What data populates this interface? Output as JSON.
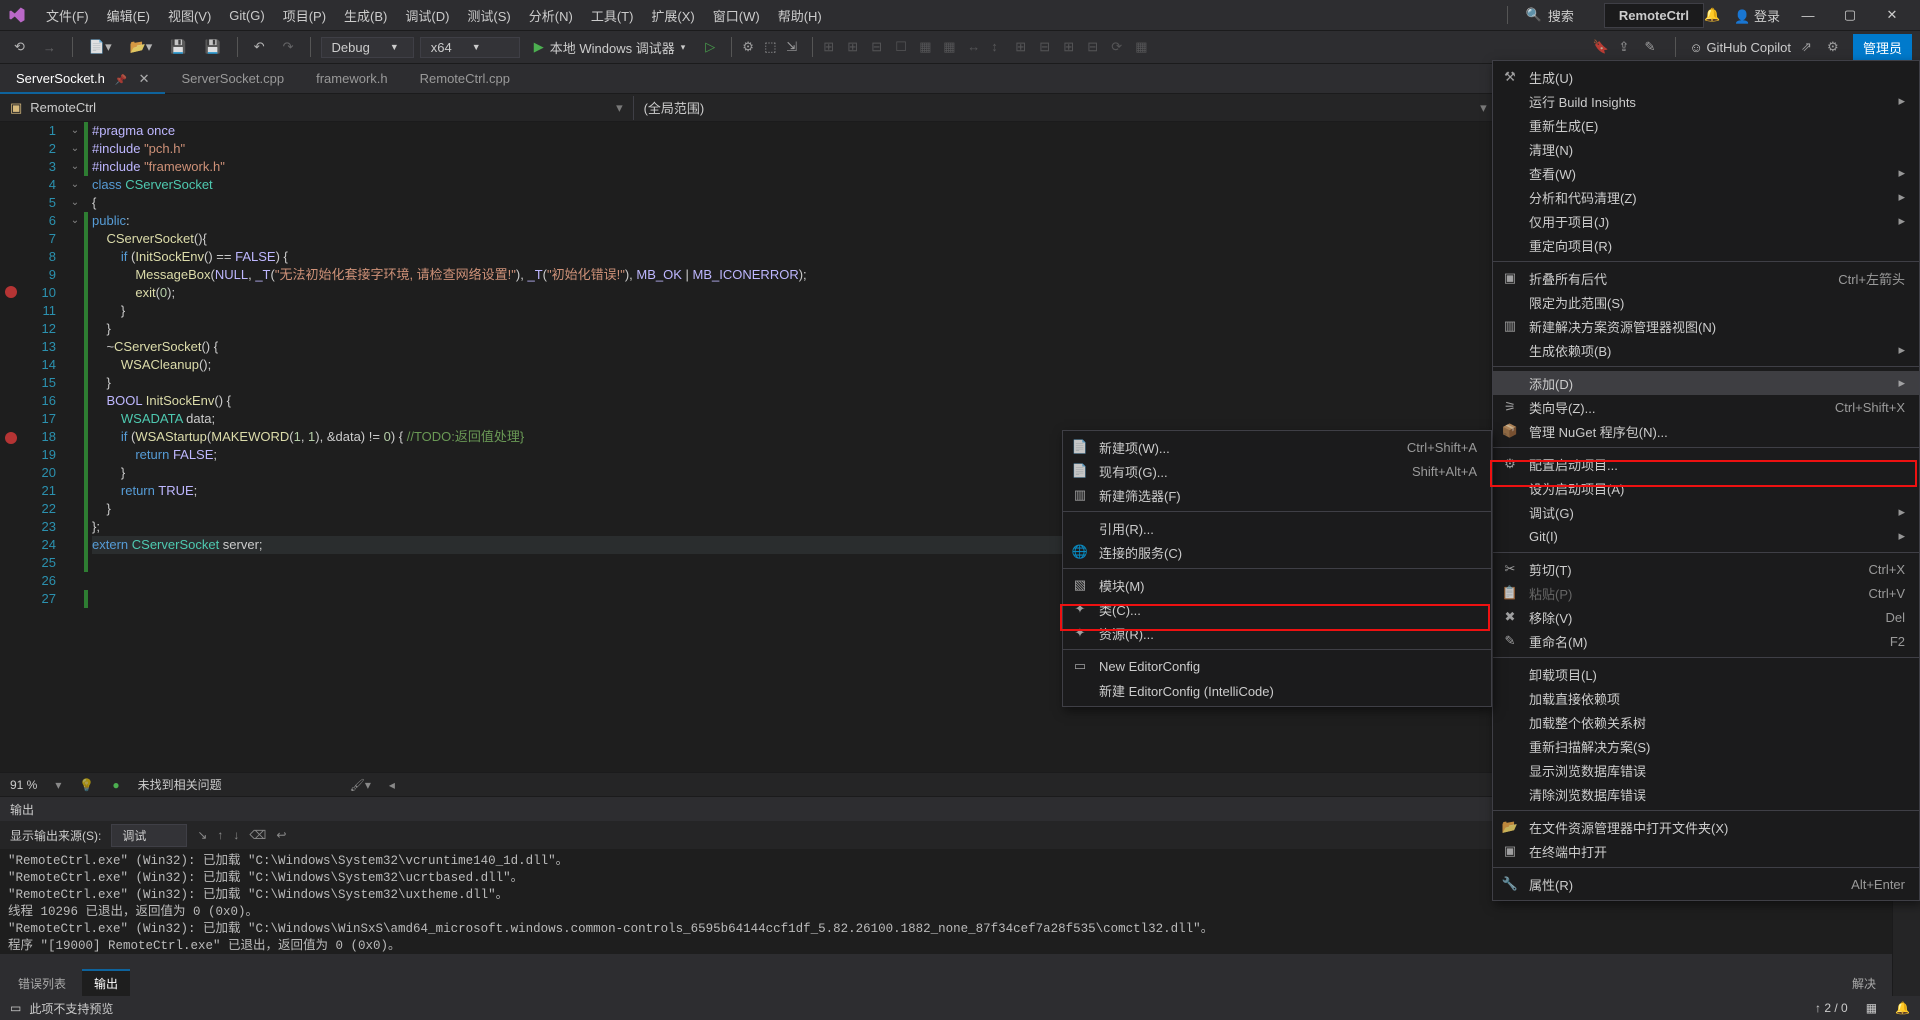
{
  "title": {
    "menus": [
      "文件(F)",
      "编辑(E)",
      "视图(V)",
      "Git(G)",
      "项目(P)",
      "生成(B)",
      "调试(D)",
      "测试(S)",
      "分析(N)",
      "工具(T)",
      "扩展(X)",
      "窗口(W)",
      "帮助(H)"
    ],
    "search_label": "搜索",
    "active_project": "RemoteCtrl",
    "signin": "登录"
  },
  "toolbar": {
    "config": "Debug",
    "platform": "x64",
    "start_label": "本地 Windows 调试器",
    "copilot": "GitHub Copilot",
    "admin": "管理员"
  },
  "tabs": [
    {
      "label": "ServerSocket.h",
      "active": true,
      "pinned": true
    },
    {
      "label": "ServerSocket.cpp"
    },
    {
      "label": "framework.h"
    },
    {
      "label": "RemoteCtrl.cpp"
    }
  ],
  "nav": {
    "class": "RemoteCtrl",
    "scope": "(全局范围)"
  },
  "code": {
    "lines": [
      {
        "n": 1,
        "bp": false,
        "fold": "",
        "g": true,
        "html": "<span class='mac'>#pragma</span> <span class='mac'>once</span>"
      },
      {
        "n": 2,
        "bp": false,
        "fold": "",
        "g": true,
        "html": "<span class='mac'>#include</span> <span class='str'>\"pch.h\"</span>"
      },
      {
        "n": 3,
        "bp": false,
        "fold": "",
        "g": true,
        "html": "<span class='mac'>#include</span> <span class='str'>\"framework.h\"</span>"
      },
      {
        "n": 4,
        "bp": false,
        "fold": "",
        "g": false,
        "html": ""
      },
      {
        "n": 5,
        "bp": false,
        "fold": "",
        "g": false,
        "html": ""
      },
      {
        "n": 6,
        "bp": false,
        "fold": "v",
        "g": true,
        "html": "<span class='kw'>class</span> <span class='cls'>CServerSocket</span>"
      },
      {
        "n": 7,
        "bp": false,
        "fold": "",
        "g": true,
        "html": "{"
      },
      {
        "n": 8,
        "bp": false,
        "fold": "",
        "g": true,
        "html": "<span class='kw'>public</span>:"
      },
      {
        "n": 9,
        "bp": false,
        "fold": "v",
        "g": true,
        "html": "    <span class='fn'>CServerSocket</span>(){"
      },
      {
        "n": 10,
        "bp": true,
        "fold": "v",
        "g": true,
        "html": "        <span class='kw'>if</span> (<span class='fn'>InitSockEnv</span>() == <span class='mac'>FALSE</span>) {"
      },
      {
        "n": 11,
        "bp": false,
        "fold": "",
        "g": true,
        "html": "            <span class='fn'>MessageBox</span>(<span class='mac'>NULL</span>, <span class='mac'>_T</span>(<span class='str'>\"无法初始化套接字环境, 请检查网络设置!\"</span>), <span class='mac'>_T</span>(<span class='str'>\"初始化错误!\"</span>), <span class='mac'>MB_OK</span> | <span class='mac'>MB_ICONERROR</span>);"
      },
      {
        "n": 12,
        "bp": false,
        "fold": "",
        "g": true,
        "html": "            <span class='fn'>exit</span>(<span class='num'>0</span>);"
      },
      {
        "n": 13,
        "bp": false,
        "fold": "",
        "g": true,
        "html": "        }"
      },
      {
        "n": 14,
        "bp": false,
        "fold": "",
        "g": true,
        "html": "    }"
      },
      {
        "n": 15,
        "bp": false,
        "fold": "v",
        "g": true,
        "html": "    ~<span class='fn'>CServerSocket</span>() {"
      },
      {
        "n": 16,
        "bp": false,
        "fold": "",
        "g": true,
        "html": "        <span class='fn'>WSACleanup</span>();"
      },
      {
        "n": 17,
        "bp": false,
        "fold": "",
        "g": true,
        "html": "    }"
      },
      {
        "n": 18,
        "bp": true,
        "fold": "v",
        "g": true,
        "html": "    <span class='mac'>BOOL</span> <span class='fn'>InitSockEnv</span>() {"
      },
      {
        "n": 19,
        "bp": false,
        "fold": "",
        "g": true,
        "html": "        <span class='cls'>WSADATA</span> data;"
      },
      {
        "n": 20,
        "bp": false,
        "fold": "v",
        "g": true,
        "html": "        <span class='kw'>if</span> (<span class='fn'>WSAStartup</span>(<span class='fn'>MAKEWORD</span>(<span class='num'>1</span>, <span class='num'>1</span>), &data) != <span class='num'>0</span>) { <span class='cmt'>//TODO:返回值处理}</span>"
      },
      {
        "n": 21,
        "bp": false,
        "fold": "",
        "g": true,
        "html": "            <span class='kw'>return</span> <span class='mac'>FALSE</span>;"
      },
      {
        "n": 22,
        "bp": false,
        "fold": "",
        "g": true,
        "html": "        }"
      },
      {
        "n": 23,
        "bp": false,
        "fold": "",
        "g": true,
        "html": "        <span class='kw'>return</span> <span class='mac'>TRUE</span>;"
      },
      {
        "n": 24,
        "bp": false,
        "fold": "",
        "g": true,
        "html": "    }"
      },
      {
        "n": 25,
        "bp": false,
        "fold": "",
        "g": true,
        "html": "};"
      },
      {
        "n": 26,
        "bp": false,
        "fold": "",
        "g": false,
        "html": ""
      },
      {
        "n": 27,
        "bp": false,
        "fold": "",
        "g": true,
        "html": "<span class='kw'>extern</span> <span class='cls'>CServerSocket</span> server;",
        "current": true
      }
    ]
  },
  "editor_status": {
    "zoom": "91 %",
    "issues": "未找到相关问题"
  },
  "output": {
    "title": "输出",
    "source_label": "显示输出来源(S):",
    "source_value": "调试",
    "body": "\"RemoteCtrl.exe\" (Win32): 已加载 \"C:\\Windows\\System32\\vcruntime140_1d.dll\"。\n\"RemoteCtrl.exe\" (Win32): 已加载 \"C:\\Windows\\System32\\ucrtbased.dll\"。\n\"RemoteCtrl.exe\" (Win32): 已加载 \"C:\\Windows\\System32\\uxtheme.dll\"。\n线程 10296 已退出，返回值为 0 (0x0)。\n\"RemoteCtrl.exe\" (Win32): 已加载 \"C:\\Windows\\WinSxS\\amd64_microsoft.windows.common-controls_6595b64144ccf1df_5.82.26100.1882_none_87f34cef7a28f535\\comctl32.dll\"。\n程序 \"[19000] RemoteCtrl.exe\" 已退出，返回值为 0 (0x0)。",
    "bottom_tabs": [
      "错误列表",
      "输出"
    ],
    "right_label": "解决"
  },
  "status": {
    "left": "此项不支持预览",
    "source_ctl": "↑ 2 / 0"
  },
  "ctx_big": [
    {
      "ico": "build",
      "label": "生成(U)"
    },
    {
      "label": "运行 Build Insights",
      "arrow": true
    },
    {
      "label": "重新生成(E)"
    },
    {
      "label": "清理(N)"
    },
    {
      "label": "查看(W)",
      "arrow": true
    },
    {
      "label": "分析和代码清理(Z)",
      "arrow": true
    },
    {
      "label": "仅用于项目(J)",
      "arrow": true
    },
    {
      "label": "重定向项目(R)"
    },
    {
      "sep": true
    },
    {
      "ico": "collapse",
      "label": "折叠所有后代",
      "short": "Ctrl+左箭头"
    },
    {
      "label": "限定为此范围(S)"
    },
    {
      "ico": "newview",
      "label": "新建解决方案资源管理器视图(N)"
    },
    {
      "label": "生成依赖项(B)",
      "arrow": true
    },
    {
      "sep": true
    },
    {
      "label": "添加(D)",
      "arrow": true,
      "hover": true
    },
    {
      "ico": "wizard",
      "label": "类向导(Z)...",
      "short": "Ctrl+Shift+X",
      "hl": true
    },
    {
      "ico": "nuget",
      "label": "管理 NuGet 程序包(N)..."
    },
    {
      "sep": true
    },
    {
      "ico": "gear",
      "label": "配置启动项目..."
    },
    {
      "label": "设为启动项目(A)"
    },
    {
      "label": "调试(G)",
      "arrow": true
    },
    {
      "label": "Git(I)",
      "arrow": true
    },
    {
      "sep": true
    },
    {
      "ico": "cut",
      "label": "剪切(T)",
      "short": "Ctrl+X"
    },
    {
      "ico": "paste",
      "label": "粘贴(P)",
      "short": "Ctrl+V",
      "disabled": true
    },
    {
      "ico": "delete",
      "label": "移除(V)",
      "short": "Del"
    },
    {
      "ico": "rename",
      "label": "重命名(M)",
      "short": "F2"
    },
    {
      "sep": true
    },
    {
      "label": "卸载项目(L)"
    },
    {
      "label": "加载直接依赖项"
    },
    {
      "label": "加载整个依赖关系树"
    },
    {
      "label": "重新扫描解决方案(S)"
    },
    {
      "label": "显示浏览数据库错误"
    },
    {
      "label": "清除浏览数据库错误"
    },
    {
      "sep": true
    },
    {
      "ico": "folder",
      "label": "在文件资源管理器中打开文件夹(X)"
    },
    {
      "ico": "terminal",
      "label": "在终端中打开"
    },
    {
      "sep": true
    },
    {
      "ico": "wrench",
      "label": "属性(R)",
      "short": "Alt+Enter"
    }
  ],
  "ctx_sub": [
    {
      "ico": "newitem",
      "label": "新建项(W)...",
      "short": "Ctrl+Shift+A"
    },
    {
      "ico": "existitem",
      "label": "现有项(G)...",
      "short": "Shift+Alt+A"
    },
    {
      "ico": "filter",
      "label": "新建筛选器(F)"
    },
    {
      "sep": true
    },
    {
      "label": "引用(R)..."
    },
    {
      "ico": "globe",
      "label": "连接的服务(C)"
    },
    {
      "sep": true
    },
    {
      "ico": "module",
      "label": "模块(M)"
    },
    {
      "ico": "class",
      "label": "类(C)...",
      "hl": true
    },
    {
      "ico": "resource",
      "label": "资源(R)..."
    },
    {
      "sep": true
    },
    {
      "ico": "editorconfig",
      "label": "New EditorConfig"
    },
    {
      "label": "新建 EditorConfig (IntelliCode)"
    }
  ]
}
